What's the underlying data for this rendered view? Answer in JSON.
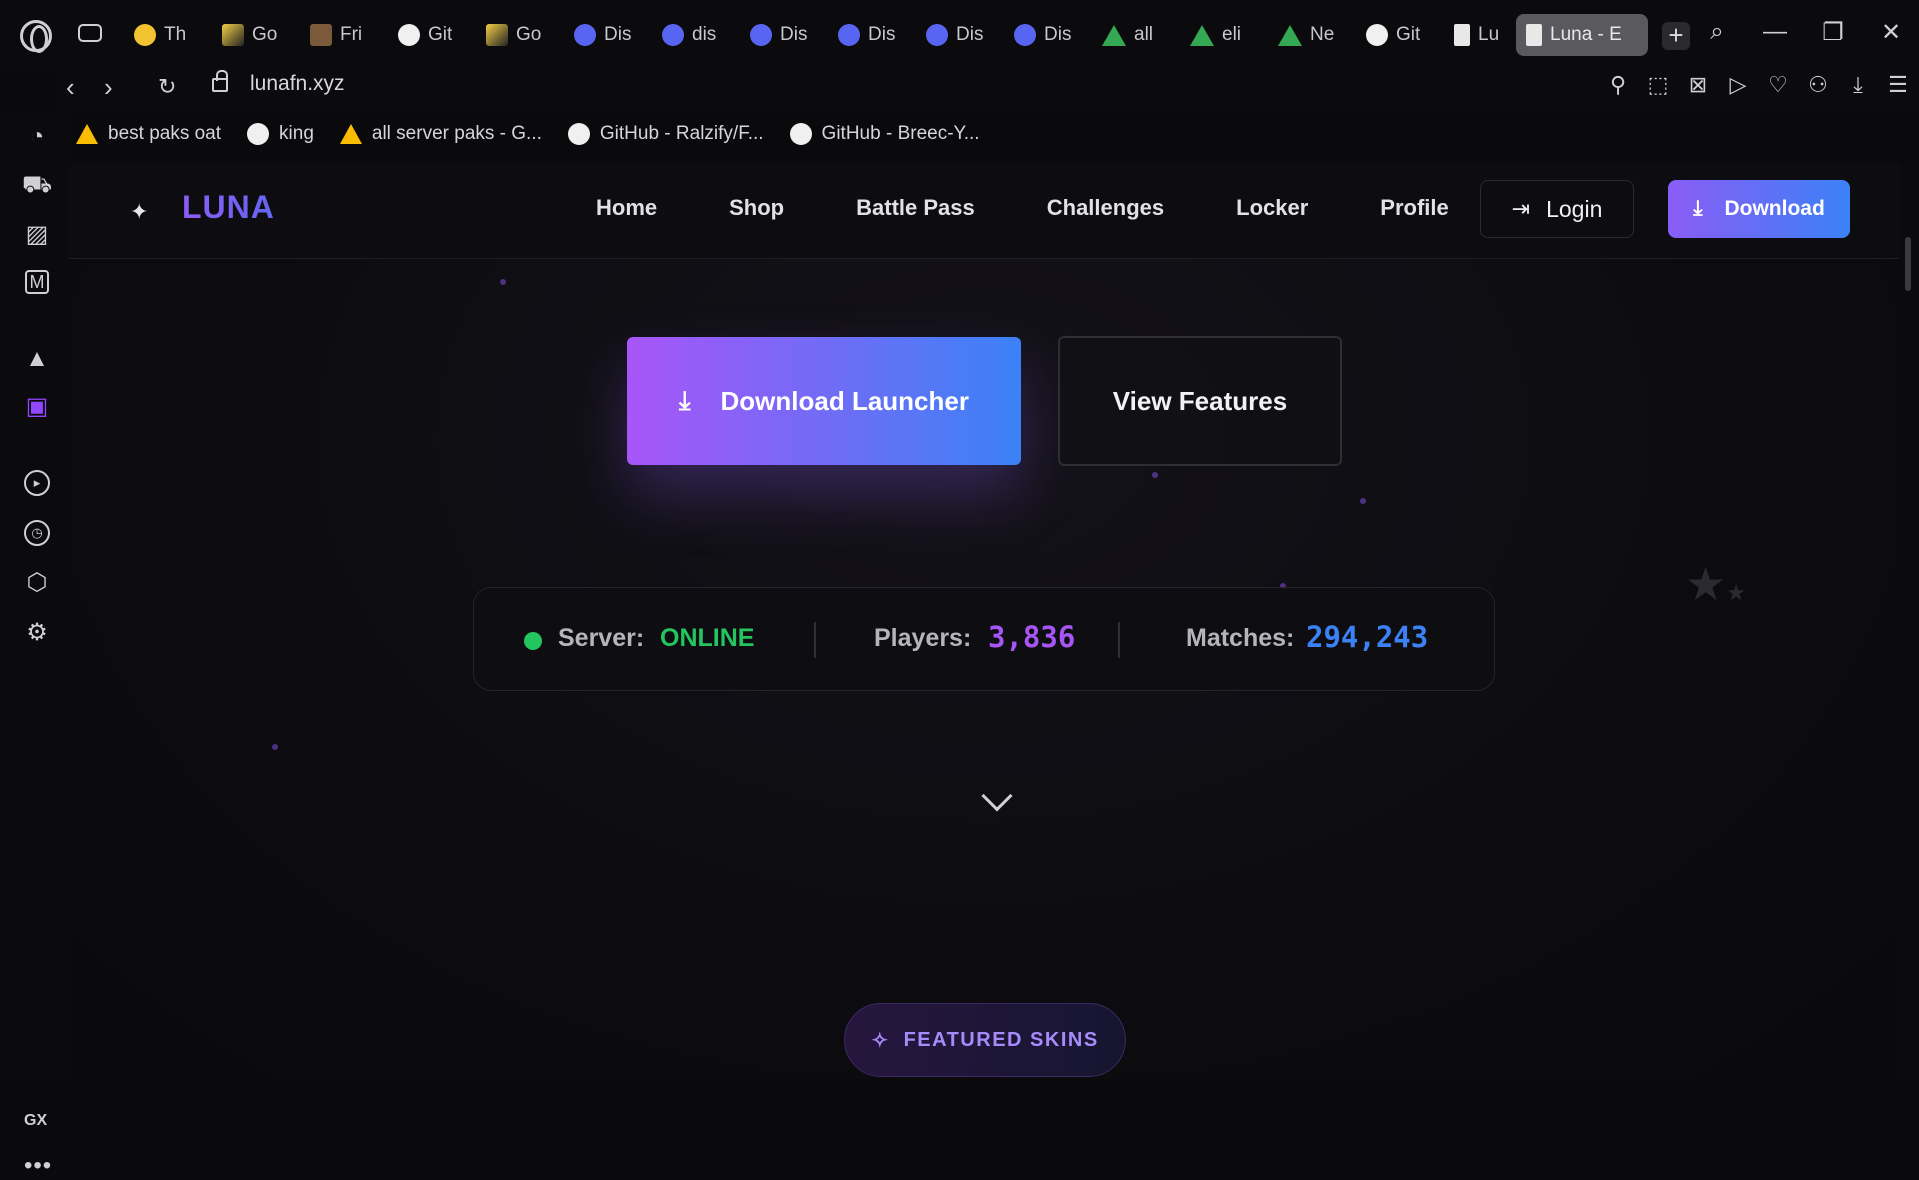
{
  "browser": {
    "tabs": [
      {
        "label": "Th",
        "icon": "emoji-icon"
      },
      {
        "label": "Go",
        "icon": "wing-icon"
      },
      {
        "label": "Fri",
        "icon": "picture-icon"
      },
      {
        "label": "Git",
        "icon": "github-icon"
      },
      {
        "label": "Go",
        "icon": "wing-icon"
      },
      {
        "label": "Dis",
        "icon": "discord-icon"
      },
      {
        "label": "dis",
        "icon": "discord-icon"
      },
      {
        "label": "Dis",
        "icon": "discord-icon"
      },
      {
        "label": "Dis",
        "icon": "discord-icon"
      },
      {
        "label": "Dis",
        "icon": "discord-icon"
      },
      {
        "label": "Dis",
        "icon": "discord-icon"
      },
      {
        "label": "all",
        "icon": "drive-icon"
      },
      {
        "label": "eli",
        "icon": "drive-icon"
      },
      {
        "label": "Ne",
        "icon": "drive-icon"
      },
      {
        "label": "Git",
        "icon": "github-icon"
      },
      {
        "label": "Lu",
        "icon": "document-icon"
      }
    ],
    "active_tab": {
      "label": "Luna - E",
      "icon": "document-icon"
    },
    "new_tab_label": "+",
    "url": "lunafn.xyz",
    "bookmarks": [
      {
        "label": "best paks oat",
        "icon": "drive-icon"
      },
      {
        "label": "king",
        "icon": "github-icon"
      },
      {
        "label": "all server paks - G...",
        "icon": "drive-icon"
      },
      {
        "label": "GitHub - Ralzify/F...",
        "icon": "github-icon"
      },
      {
        "label": "GitHub - Breec-Y...",
        "icon": "github-icon"
      }
    ],
    "sidebar_label": "GX",
    "more_label": "•••"
  },
  "site": {
    "brand": "LUNA",
    "nav": [
      "Home",
      "Shop",
      "Battle Pass",
      "Challenges",
      "Locker",
      "Profile"
    ],
    "login_label": "Login",
    "download_label": "Download",
    "hero_primary": "Download Launcher",
    "hero_secondary": "View Features",
    "stats": {
      "server_label": "Server:",
      "server_value": "ONLINE",
      "players_label": "Players:",
      "players_value": "3,836",
      "matches_label": "Matches:",
      "matches_value": "294,243"
    },
    "featured_label": "FEATURED SKINS"
  },
  "colors": {
    "accent_purple": "#8b5cf6",
    "accent_blue": "#3b82f6",
    "online_green": "#22c55e",
    "players_color": "#a855f7",
    "matches_color": "#3b82f6"
  }
}
